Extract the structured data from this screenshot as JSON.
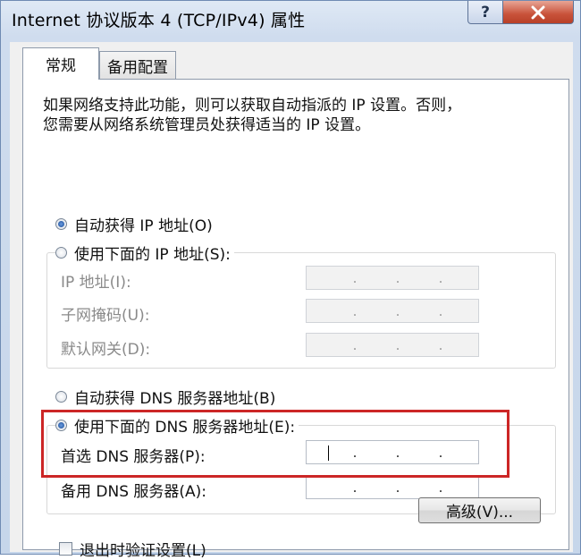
{
  "window": {
    "title": "Internet 协议版本 4 (TCP/IPv4) 属性",
    "help_label": "?"
  },
  "tabs": [
    {
      "label": "常规",
      "selected": true
    },
    {
      "label": "备用配置",
      "selected": false
    }
  ],
  "description": "如果网络支持此功能，则可以获取自动指派的 IP 设置。否则，\n您需要从网络系统管理员处获得适当的 IP 设置。",
  "ip_section": {
    "auto_label": "自动获得 IP 地址(O)",
    "auto_checked": true,
    "manual_label": "使用下面的 IP 地址(S):",
    "manual_checked": false,
    "fields": [
      {
        "label": "IP 地址(I):",
        "value": "  .   .   .",
        "enabled": false
      },
      {
        "label": "子网掩码(U):",
        "value": "  .   .   .",
        "enabled": false
      },
      {
        "label": "默认网关(D):",
        "value": "  .   .   .",
        "enabled": false
      }
    ]
  },
  "dns_section": {
    "auto_label": "自动获得 DNS 服务器地址(B)",
    "auto_checked": false,
    "manual_label": "使用下面的 DNS 服务器地址(E):",
    "manual_checked": true,
    "preferred": {
      "label": "首选 DNS 服务器(P):",
      "value": "",
      "enabled": true
    },
    "alternate": {
      "label": "备用 DNS 服务器(A):",
      "value": "",
      "enabled": true
    }
  },
  "validate_label": "退出时验证设置(L)",
  "validate_checked": false,
  "advanced_label": "高级(V)...",
  "colors": {
    "highlight_box": "#cc2626",
    "close_button": "#c8523a",
    "title_bar": "#cfdcee"
  },
  "icons": {
    "close": "close-icon"
  }
}
